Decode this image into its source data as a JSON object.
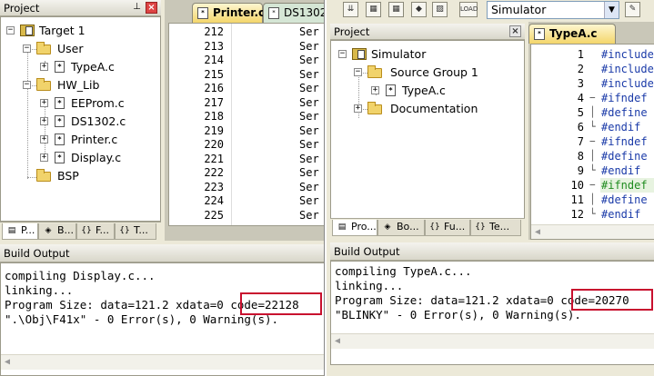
{
  "left": {
    "project_title": "Project",
    "pin": "ᴾ",
    "close": "×",
    "tree": {
      "target": "Target 1",
      "user": "User",
      "typea": "TypeA.c",
      "hwlib": "HW_Lib",
      "eeprom": "EEProm.c",
      "ds1302": "DS1302.c",
      "printer": "Printer.c",
      "display": "Display.c",
      "bsp": "BSP"
    },
    "bottom_tabs": [
      "P...",
      "B...",
      "F...",
      "T..."
    ],
    "editor_tabs": [
      "Printer.c",
      "DS1302"
    ],
    "line_numbers": [
      "212",
      "213",
      "214",
      "215",
      "216",
      "217",
      "218",
      "219",
      "220",
      "221",
      "222",
      "223",
      "224",
      "225"
    ],
    "code_text": "Ser",
    "build_title": "Build Output",
    "build": [
      "compiling Display.c...",
      "linking...",
      "Program Size: data=121.2 xdata=0 code=22128",
      "\".\\Obj\\F41x\" - 0 Error(s), 0 Warning(s)."
    ]
  },
  "right": {
    "toolbar": {
      "target_select": "Simulator",
      "dropdown_arrow": "▼"
    },
    "project_title": "Project",
    "close": "×",
    "tree": {
      "target": "Simulator",
      "source_group": "Source Group 1",
      "typea": "TypeA.c",
      "documentation": "Documentation"
    },
    "bottom_tabs": [
      "Pro...",
      "Bo...",
      "Fu...",
      "Te..."
    ],
    "editor_tab": "TypeA.c",
    "line_numbers": [
      "1",
      "2",
      "3",
      "4",
      "5",
      "6",
      "7",
      "8",
      "9",
      "10",
      "11",
      "12"
    ],
    "code_lines": [
      "#include",
      "#include",
      "#include",
      "#ifndef",
      "#define",
      "#endif",
      "#ifndef",
      "#define",
      "#endif",
      "#ifndef",
      "#define",
      "#endif"
    ],
    "build_title": "Build Output",
    "build": [
      "compiling TypeA.c...",
      "linking...",
      "Program Size: data=121.2 xdata=0 code=20270",
      "\"BLINKY\" - 0 Error(s), 0 Warning(s)."
    ]
  },
  "colors": {
    "highlight_box": "#c8102e",
    "keyword_blue": "#1a3aa8",
    "keyword_green": "#1e8b1e"
  }
}
